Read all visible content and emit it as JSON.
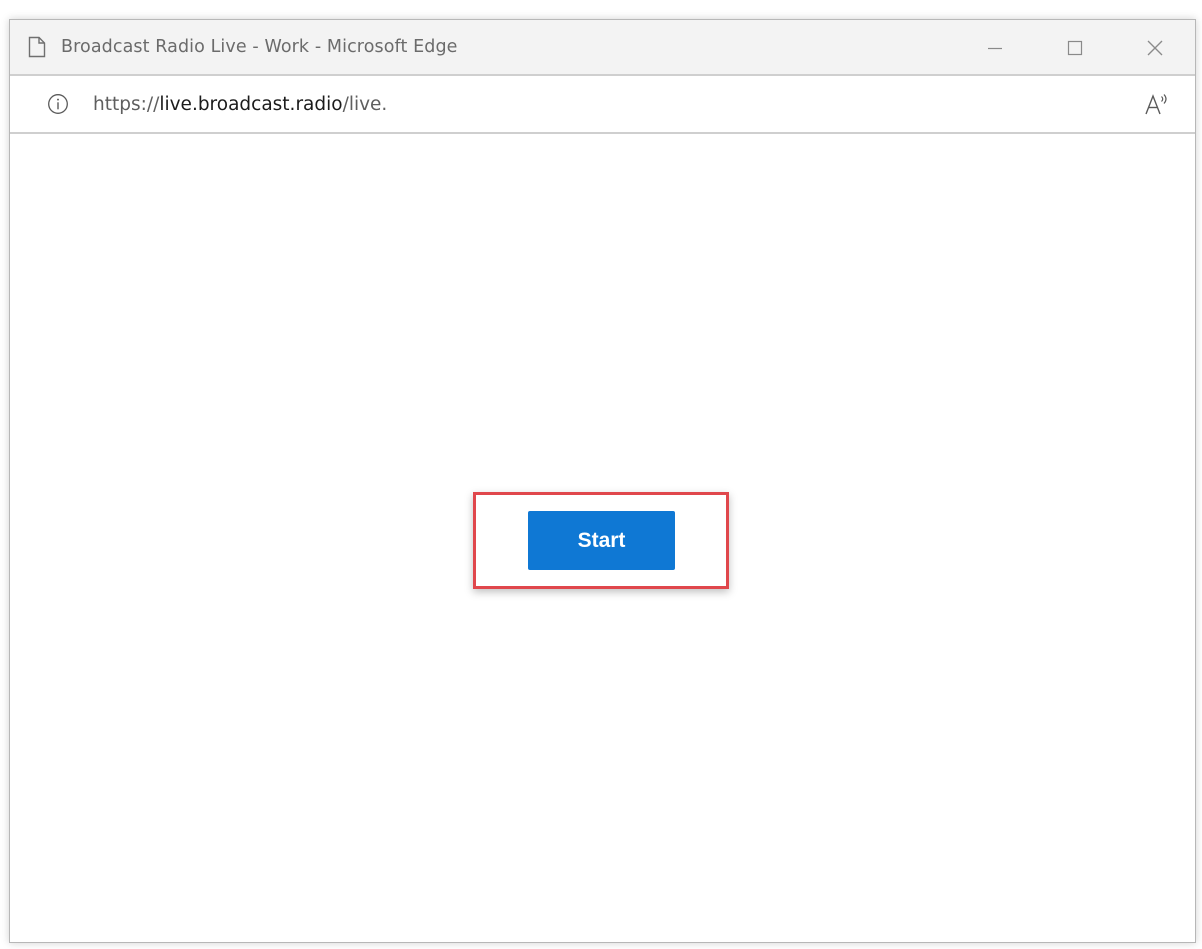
{
  "window": {
    "title": "Broadcast Radio Live - Work - Microsoft Edge"
  },
  "controls": {
    "minimize_icon": "minimize-icon",
    "maximize_icon": "maximize-icon",
    "close_icon": "close-icon"
  },
  "address": {
    "scheme": "https://",
    "host": "live.broadcast.radio",
    "path": "/live.",
    "info_icon": "info-icon",
    "read_aloud_icon": "read-aloud-icon"
  },
  "main": {
    "start_label": "Start"
  },
  "colors": {
    "accent": "#0f78d4",
    "highlight": "#e0474c",
    "titlebar_bg": "#f3f3f3"
  }
}
